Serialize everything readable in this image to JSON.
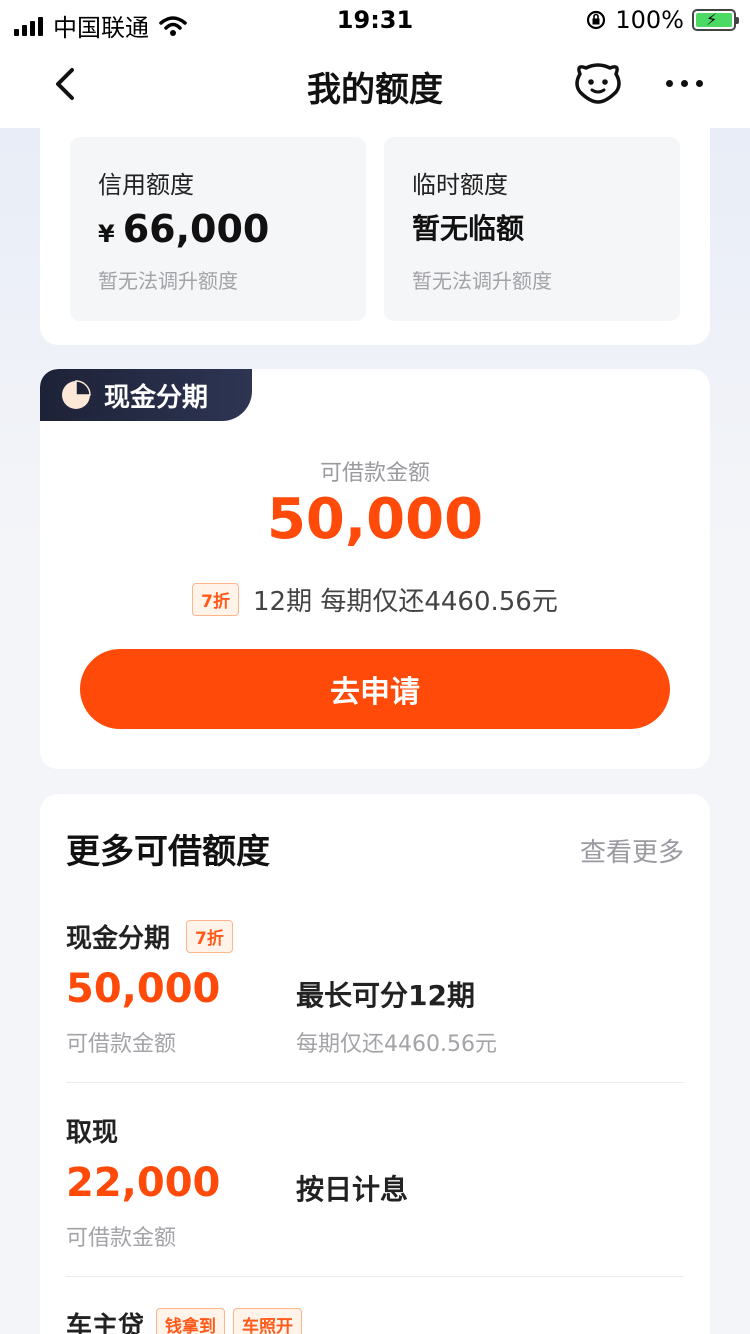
{
  "status_bar": {
    "carrier": "中国联通",
    "time": "19:31",
    "battery": "100%"
  },
  "nav": {
    "title": "我的额度"
  },
  "quota": {
    "credit_label": "信用额度",
    "credit_currency": "¥",
    "credit_amount": "66,000",
    "credit_hint": "暂无法调升额度",
    "temp_label": "临时额度",
    "temp_value": "暂无临额",
    "temp_hint": "暂无法调升额度"
  },
  "cash_installment": {
    "tag": "现金分期",
    "sub_label": "可借款金额",
    "amount": "50,000",
    "discount": "7折",
    "plan_text": "12期 每期仅还4460.56元",
    "apply_label": "去申请"
  },
  "more_quota": {
    "title": "更多可借额度",
    "view_more": "查看更多",
    "items": [
      {
        "name": "现金分期",
        "tags": [
          "7折"
        ],
        "amount": "50,000",
        "amount_label": "可借款金额",
        "desc": "最长可分12期",
        "desc_sub": "每期仅还4460.56元"
      },
      {
        "name": "取现",
        "amount": "22,000",
        "amount_label": "可借款金额",
        "desc": "按日计息"
      },
      {
        "name": "车主贷",
        "tags": [
          "钱拿到",
          "车照开"
        ]
      }
    ]
  }
}
